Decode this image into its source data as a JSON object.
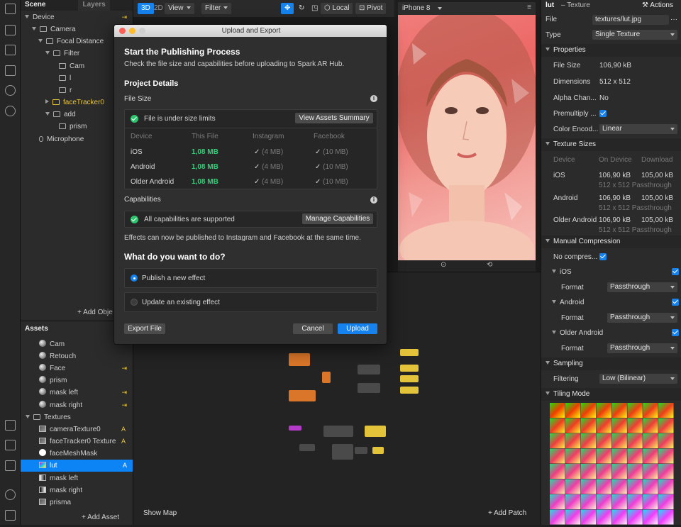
{
  "scene": {
    "tabs": [
      "Scene",
      "Layers"
    ],
    "tree": [
      {
        "label": "Device"
      },
      {
        "label": "Camera"
      },
      {
        "label": "Focal Distance"
      },
      {
        "label": "Filter"
      },
      {
        "label": "Cam"
      },
      {
        "label": "l"
      },
      {
        "label": "r"
      },
      {
        "label": "faceTracker0"
      },
      {
        "label": "add"
      },
      {
        "label": "prism"
      },
      {
        "label": "Microphone"
      }
    ],
    "add_object": "+ Add Obje"
  },
  "assets": {
    "title": "Assets",
    "items": [
      {
        "label": "Cam"
      },
      {
        "label": "Retouch"
      },
      {
        "label": "Face"
      },
      {
        "label": "prism"
      },
      {
        "label": "mask left"
      },
      {
        "label": "mask right"
      },
      {
        "label": "Textures"
      },
      {
        "label": "cameraTexture0",
        "badge": "A"
      },
      {
        "label": "faceTracker0 Texture",
        "badge": "A"
      },
      {
        "label": "faceMeshMask"
      },
      {
        "label": "lut",
        "badge": "A"
      },
      {
        "label": "mask left"
      },
      {
        "label": "mask right"
      },
      {
        "label": "prisma"
      }
    ],
    "add_asset": "+ Add Asset"
  },
  "topbar": {
    "mode_3d": "3D",
    "mode_2d": "2D",
    "view": "View",
    "filter": "Filter",
    "local": "Local",
    "pivot": "Pivot"
  },
  "device": {
    "name": "iPhone 8"
  },
  "patch": {
    "show_map": "Show Map",
    "add_patch": "+ Add Patch"
  },
  "dialog": {
    "title": "Upload and Export",
    "heading": "Start the Publishing Process",
    "intro": "Check the file size and capabilities before uploading to Spark AR Hub.",
    "project_details": "Project Details",
    "file_size": "File Size",
    "size_status": "File is under size limits",
    "view_assets": "View Assets Summary",
    "columns": [
      "Device",
      "This File",
      "Instagram",
      "Facebook"
    ],
    "rows": [
      {
        "device": "iOS",
        "size": "1,08 MB",
        "instagram": "(4 MB)",
        "facebook": "(10 MB)"
      },
      {
        "device": "Android",
        "size": "1,08 MB",
        "instagram": "(4 MB)",
        "facebook": "(10 MB)"
      },
      {
        "device": "Older Android",
        "size": "1,08 MB",
        "instagram": "(4 MB)",
        "facebook": "(10 MB)"
      }
    ],
    "capabilities": "Capabilities",
    "cap_status": "All capabilities are supported",
    "manage_caps": "Manage Capabilities",
    "publish_note": "Effects can now be published to Instagram and Facebook at the same time.",
    "question": "What do you want to do?",
    "option_new": "Publish a new effect",
    "option_update": "Update an existing effect",
    "export_file": "Export File",
    "cancel": "Cancel",
    "upload": "Upload"
  },
  "inspector": {
    "name": "lut",
    "kind": "– Texture",
    "actions": "Actions",
    "file_label": "File",
    "file_value": "textures/lut.jpg",
    "file_more": "···",
    "type_label": "Type",
    "type_value": "Single Texture",
    "properties": "Properties",
    "props": [
      {
        "label": "File Size",
        "value": "106,90 kB"
      },
      {
        "label": "Dimensions",
        "value": "512 x 512"
      },
      {
        "label": "Alpha Chan...",
        "value": "No"
      },
      {
        "label": "Premultiply ..."
      },
      {
        "label": "Color Encod...",
        "value": "Linear"
      }
    ],
    "texture_sizes": "Texture Sizes",
    "ts_columns": [
      "Device",
      "On Device",
      "Download"
    ],
    "ts_rows": [
      {
        "device": "iOS",
        "on_device": "106,90 kB",
        "download": "105,00 kB",
        "detail": "512 x 512 Passthrough"
      },
      {
        "device": "Android",
        "on_device": "106,90 kB",
        "download": "105,00 kB",
        "detail": "512 x 512 Passthrough"
      },
      {
        "device": "Older Android",
        "on_device": "106,90 kB",
        "download": "105,00 kB",
        "detail": "512 x 512 Passthrough"
      }
    ],
    "manual_compression": "Manual Compression",
    "no_compress": "No compres...",
    "platforms": [
      {
        "name": "iOS",
        "format_label": "Format",
        "format": "Passthrough"
      },
      {
        "name": "Android",
        "format_label": "Format",
        "format": "Passthrough"
      },
      {
        "name": "Older Android",
        "format_label": "Format",
        "format": "Passthrough"
      }
    ],
    "sampling": "Sampling",
    "filtering_label": "Filtering",
    "filtering_value": "Low (Bilinear)",
    "tiling_mode": "Tiling Mode"
  },
  "colors": {
    "accent": "#1582ee",
    "success": "#2ed376",
    "warning": "#e8c53a"
  }
}
